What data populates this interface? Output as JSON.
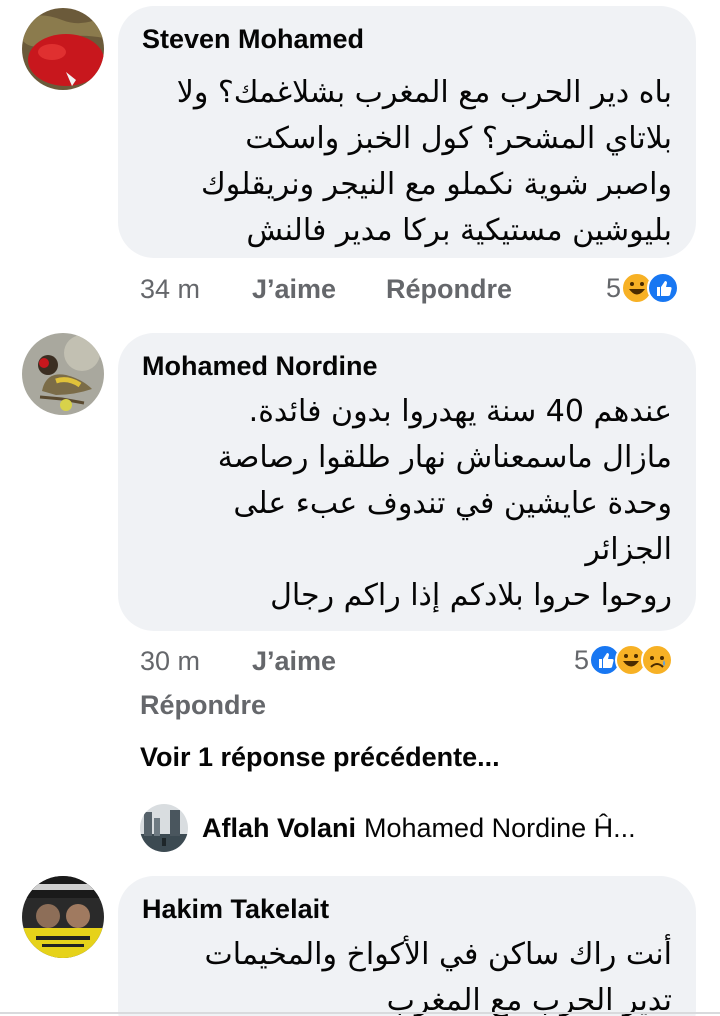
{
  "comments": [
    {
      "author": "Steven Mohamed",
      "lines": [
        "باه دير الحرب مع المغرب بشلاغمك؟ ولا",
        "بلاتاي المشحر؟ كول الخبز واسكت",
        "واصبر شوية نكملو مع النيجر ونريقلوك",
        "بليوشين مستيكية بركا مدير فالنش"
      ],
      "time": "34 m",
      "like_label": "J’aime",
      "reply_label": "Répondre",
      "reaction_count": "5",
      "reaction_icons": [
        "haha-icon",
        "like-icon"
      ]
    },
    {
      "author": "Mohamed Nordine",
      "lines": [
        "عندهم 40 سنة يهدروا بدون فائدة.",
        "مازال ماسمعناش نهار طلقوا رصاصة",
        "وحدة عايشين في تندوف عبء على",
        "الجزائر",
        "روحوا حروا بلادكم إذا راكم رجال"
      ],
      "time": "30 m",
      "like_label": "J’aime",
      "reply_label": "Répondre",
      "reaction_count": "5",
      "reaction_icons": [
        "like-icon",
        "haha-icon",
        "sad-icon"
      ]
    },
    {
      "author": "Hakim Takelait",
      "lines": [
        "أنت راك ساكن في الأكواخ والمخيمات",
        "تدير الحرب مع المغرب"
      ]
    }
  ],
  "previous_replies_label": "Voir 1 réponse précédente...",
  "latest_reply": {
    "author": "Aflah Volani",
    "snippet": "Mohamed Nordine Ĥ..."
  },
  "colors": {
    "bubble": "#f0f2f5",
    "meta_text": "#65676b",
    "like_blue": "#1877f2",
    "emoji_yellow": "#f7b125"
  }
}
